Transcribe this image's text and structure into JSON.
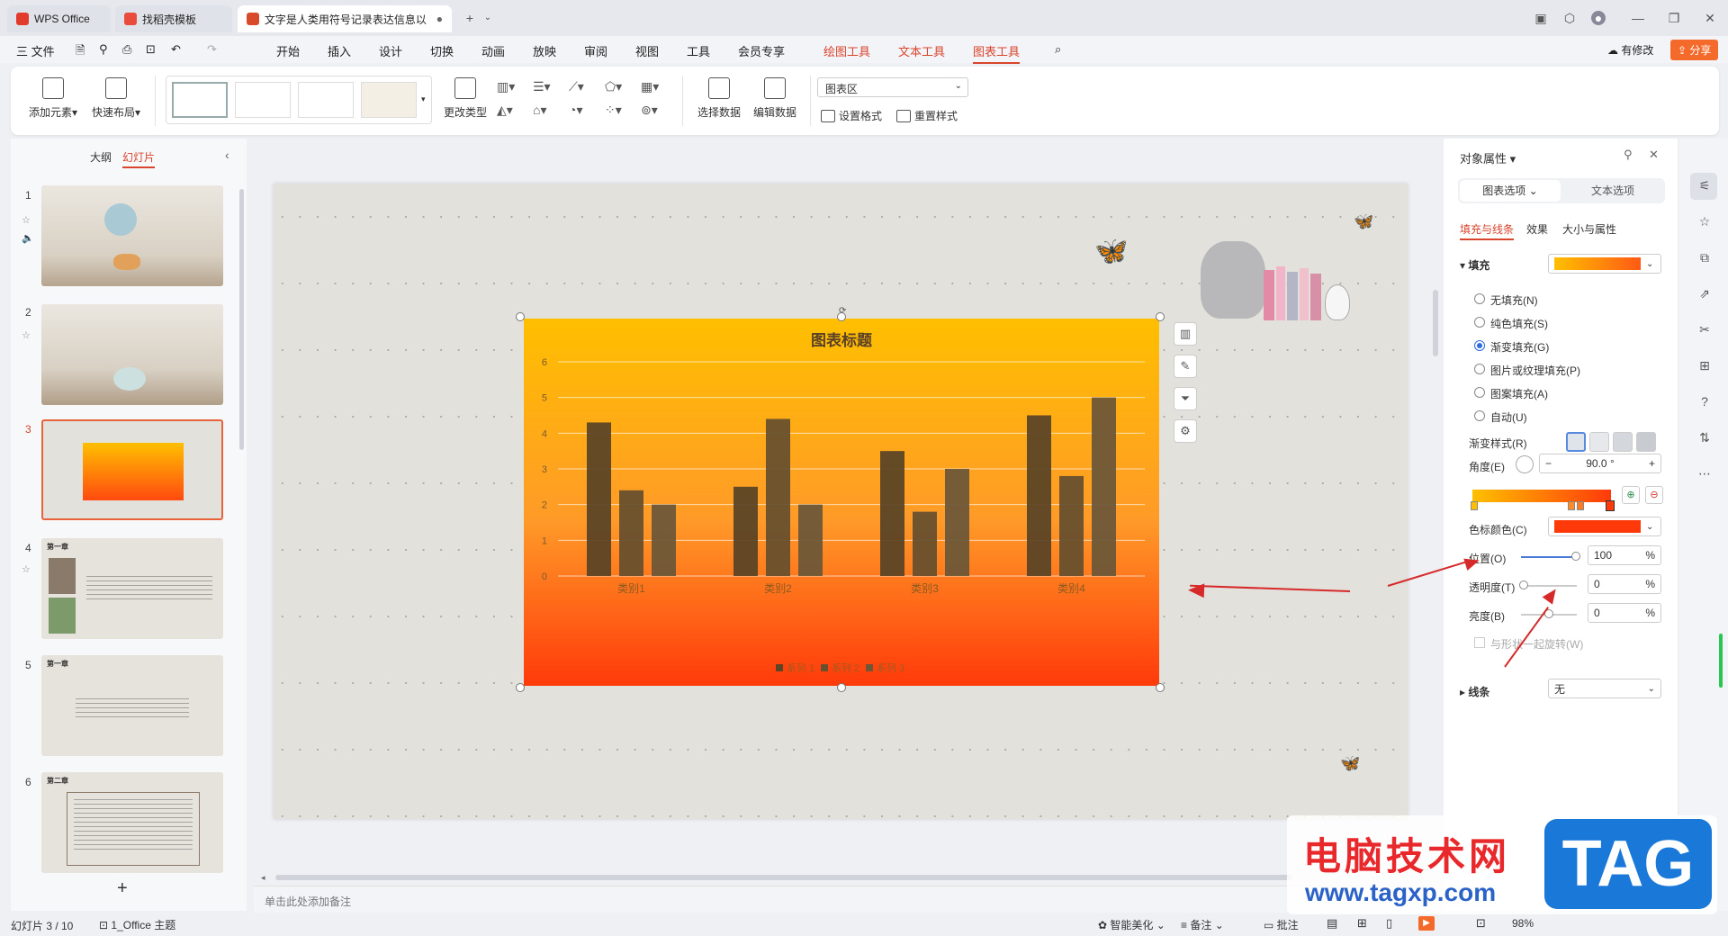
{
  "tabs": [
    {
      "label": "WPS Office",
      "active": false
    },
    {
      "label": "找稻壳模板",
      "active": false
    },
    {
      "label": "文字是人类用符号记录表达信息以",
      "active": true
    }
  ],
  "menu": {
    "file": "三 文件",
    "items": [
      "开始",
      "插入",
      "设计",
      "切换",
      "动画",
      "放映",
      "审阅",
      "视图",
      "工具",
      "会员专享"
    ],
    "contextual": [
      "绘图工具",
      "文本工具"
    ],
    "active": "图表工具",
    "modified": "有修改",
    "share": "分享"
  },
  "ribbon": {
    "add_element": "添加元素",
    "quick_layout": "快速布局",
    "change_type": "更改类型",
    "select_data": "选择数据",
    "edit_data": "编辑数据",
    "chart_area": "图表区",
    "set_format": "设置格式",
    "reset_style": "重置样式"
  },
  "left_panel": {
    "tab_outline": "大纲",
    "tab_slides": "幻灯片",
    "slides": [
      "1",
      "2",
      "3",
      "4",
      "5",
      "6"
    ],
    "selected": 3,
    "slide4_title": "第一章",
    "slide5_title": "第一章",
    "slide6_title": "第二章"
  },
  "chart_data": {
    "type": "bar",
    "title": "图表标题",
    "categories": [
      "类别1",
      "类别2",
      "类别3",
      "类别4"
    ],
    "series": [
      {
        "name": "系列 1",
        "values": [
          4.3,
          2.5,
          3.5,
          4.5
        ]
      },
      {
        "name": "系列 2",
        "values": [
          2.4,
          4.4,
          1.8,
          2.8
        ]
      },
      {
        "name": "系列 3",
        "values": [
          2.0,
          2.0,
          3.0,
          5.0
        ]
      }
    ],
    "ylim": [
      0,
      6
    ],
    "yticks": [
      "0",
      "1",
      "2",
      "3",
      "4",
      "5",
      "6"
    ],
    "grid": true,
    "legend": "bottom",
    "colors": {
      "series1": "#5c4426",
      "series2": "#68502e",
      "series3": "#6e5738",
      "bg_top": "#ffbf00",
      "bg_bottom": "#ff3a0a"
    }
  },
  "notes_placeholder": "单击此处添加备注",
  "props": {
    "title": "对象属性",
    "tab_chart": "图表选项",
    "tab_text": "文本选项",
    "sub_fill": "填充与线条",
    "sub_effect": "效果",
    "sub_size": "大小与属性",
    "fill": "填充",
    "options": [
      "无填充(N)",
      "纯色填充(S)",
      "渐变填充(G)",
      "图片或纹理填充(P)",
      "图案填充(A)",
      "自动(U)"
    ],
    "gradient_style": "渐变样式(R)",
    "angle_label": "角度(E)",
    "angle_value": "90.0 °",
    "stop_color": "色标颜色(C)",
    "position_label": "位置(O)",
    "position_value": "100",
    "transparency_label": "透明度(T)",
    "transparency_value": "0",
    "brightness_label": "亮度(B)",
    "brightness_value": "0",
    "rotate_with_shape": "与形状一起旋转(W)",
    "line_label": "线条",
    "line_value": "无",
    "percent": "%"
  },
  "status": {
    "slide_info": "幻灯片 3 / 10",
    "theme": "1_Office 主题",
    "beautify": "智能美化",
    "notes": "备注",
    "comments": "批注",
    "zoom": "98%"
  },
  "watermark": {
    "site_name": "电脑技术网",
    "url": "www.tagxp.com",
    "tag": "TAG"
  }
}
